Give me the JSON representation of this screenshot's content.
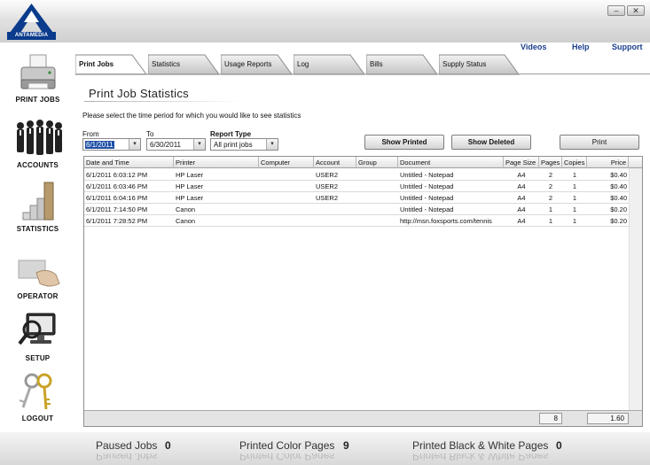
{
  "brand": {
    "name": "ANTAMEDIA",
    "accent": "#0a3b8c"
  },
  "window": {
    "minimize_icon": "minimize-icon",
    "close_icon": "close-icon"
  },
  "sidebar": {
    "items": [
      {
        "label": "PRINT JOBS",
        "icon": "printer-icon"
      },
      {
        "label": "ACCOUNTS",
        "icon": "people-icon"
      },
      {
        "label": "STATISTICS",
        "icon": "bar-chart-icon"
      },
      {
        "label": "OPERATOR",
        "icon": "card-icon"
      },
      {
        "label": "SETUP",
        "icon": "monitor-magnifier-icon"
      },
      {
        "label": "LOGOUT",
        "icon": "keys-icon"
      }
    ]
  },
  "top_links": [
    "Videos",
    "Help",
    "Support"
  ],
  "tabs": [
    {
      "label": "Print Jobs",
      "active": true
    },
    {
      "label": "Statistics",
      "active": false
    },
    {
      "label": "Usage Reports",
      "active": false
    },
    {
      "label": "Log",
      "active": false
    },
    {
      "label": "Bills",
      "active": false
    },
    {
      "label": "Supply Status",
      "active": false
    }
  ],
  "panel": {
    "title": "Print Job Statistics",
    "instructions": "Please select the time period for which you would like to see statistics",
    "from_label": "From",
    "from_value": "6/1/2011",
    "to_label": "To",
    "to_value": "6/30/2011",
    "report_type_label": "Report Type",
    "report_type_value": "All print jobs",
    "show_printed": "Show Printed",
    "show_deleted": "Show Deleted",
    "print": "Print"
  },
  "grid": {
    "columns": [
      "Date and Time",
      "Printer",
      "Computer",
      "Account",
      "Group",
      "Document",
      "Page Size",
      "Pages",
      "Copies",
      "Price"
    ],
    "rows": [
      [
        "6/1/2011 6:03:12 PM",
        "HP Laser",
        "",
        "USER2",
        "",
        "Untitled - Notepad",
        "A4",
        "2",
        "1",
        "$0.40"
      ],
      [
        "6/1/2011 6:03:46 PM",
        "HP Laser",
        "",
        "USER2",
        "",
        "Untitled - Notepad",
        "A4",
        "2",
        "1",
        "$0.40"
      ],
      [
        "6/1/2011 6:04:16 PM",
        "HP Laser",
        "",
        "USER2",
        "",
        "Untitled - Notepad",
        "A4",
        "2",
        "1",
        "$0.40"
      ],
      [
        "6/1/2011 7:14:50 PM",
        "Canon",
        "",
        "",
        "",
        "Untitled - Notepad",
        "A4",
        "1",
        "1",
        "$0.20"
      ],
      [
        "6/1/2011 7:28:52 PM",
        "Canon",
        "",
        "",
        "",
        "http://msn.foxsports.com/tennis",
        "A4",
        "1",
        "1",
        "$0.20"
      ]
    ],
    "total_pages": "8",
    "total_price": "1.60"
  },
  "status": {
    "paused_label": "Paused Jobs",
    "paused_value": "0",
    "color_label": "Printed Color Pages",
    "color_value": "9",
    "bw_label": "Printed Black & White Pages",
    "bw_value": "0"
  }
}
